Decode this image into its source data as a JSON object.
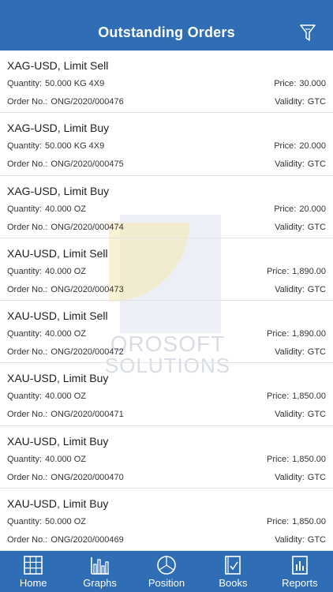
{
  "header": {
    "title": "Outstanding Orders",
    "filter_icon": "filter-icon"
  },
  "watermark": {
    "line1": "OROSOFT",
    "line2": "SOLUTIONS"
  },
  "labels": {
    "quantity": "Quantity:",
    "order_no": "Order No.:",
    "price": "Price:",
    "validity": "Validity:"
  },
  "orders": [
    {
      "title": "XAG-USD, Limit Sell",
      "quantity": "50.000 KG 4X9",
      "price": "30.000",
      "order_no": "ONG/2020/000476",
      "validity": "GTC"
    },
    {
      "title": "XAG-USD, Limit Buy",
      "quantity": "50.000 KG 4X9",
      "price": "20.000",
      "order_no": "ONG/2020/000475",
      "validity": "GTC"
    },
    {
      "title": "XAG-USD, Limit Buy",
      "quantity": "40.000 OZ",
      "price": "20.000",
      "order_no": "ONG/2020/000474",
      "validity": "GTC"
    },
    {
      "title": "XAU-USD, Limit Sell",
      "quantity": "40.000 OZ",
      "price": "1,890.00",
      "order_no": "ONG/2020/000473",
      "validity": "GTC"
    },
    {
      "title": "XAU-USD, Limit Sell",
      "quantity": "40.000 OZ",
      "price": "1,890.00",
      "order_no": "ONG/2020/000472",
      "validity": "GTC"
    },
    {
      "title": "XAU-USD, Limit Buy",
      "quantity": "40.000 OZ",
      "price": "1,850.00",
      "order_no": "ONG/2020/000471",
      "validity": "GTC"
    },
    {
      "title": "XAU-USD, Limit Buy",
      "quantity": "40.000 OZ",
      "price": "1,850.00",
      "order_no": "ONG/2020/000470",
      "validity": "GTC"
    },
    {
      "title": "XAU-USD, Limit Buy",
      "quantity": "50.000 OZ",
      "price": "1,850.00",
      "order_no": "ONG/2020/000469",
      "validity": "GTC"
    }
  ],
  "tabs": [
    {
      "label": "Home",
      "icon": "grid-icon"
    },
    {
      "label": "Graphs",
      "icon": "bar-chart-icon"
    },
    {
      "label": "Position",
      "icon": "pie-chart-icon"
    },
    {
      "label": "Books",
      "icon": "book-icon"
    },
    {
      "label": "Reports",
      "icon": "report-icon"
    }
  ],
  "colors": {
    "primary": "#2f6db5",
    "watermark_gold": "#f5e7b5",
    "watermark_blue": "#dde3ee"
  }
}
